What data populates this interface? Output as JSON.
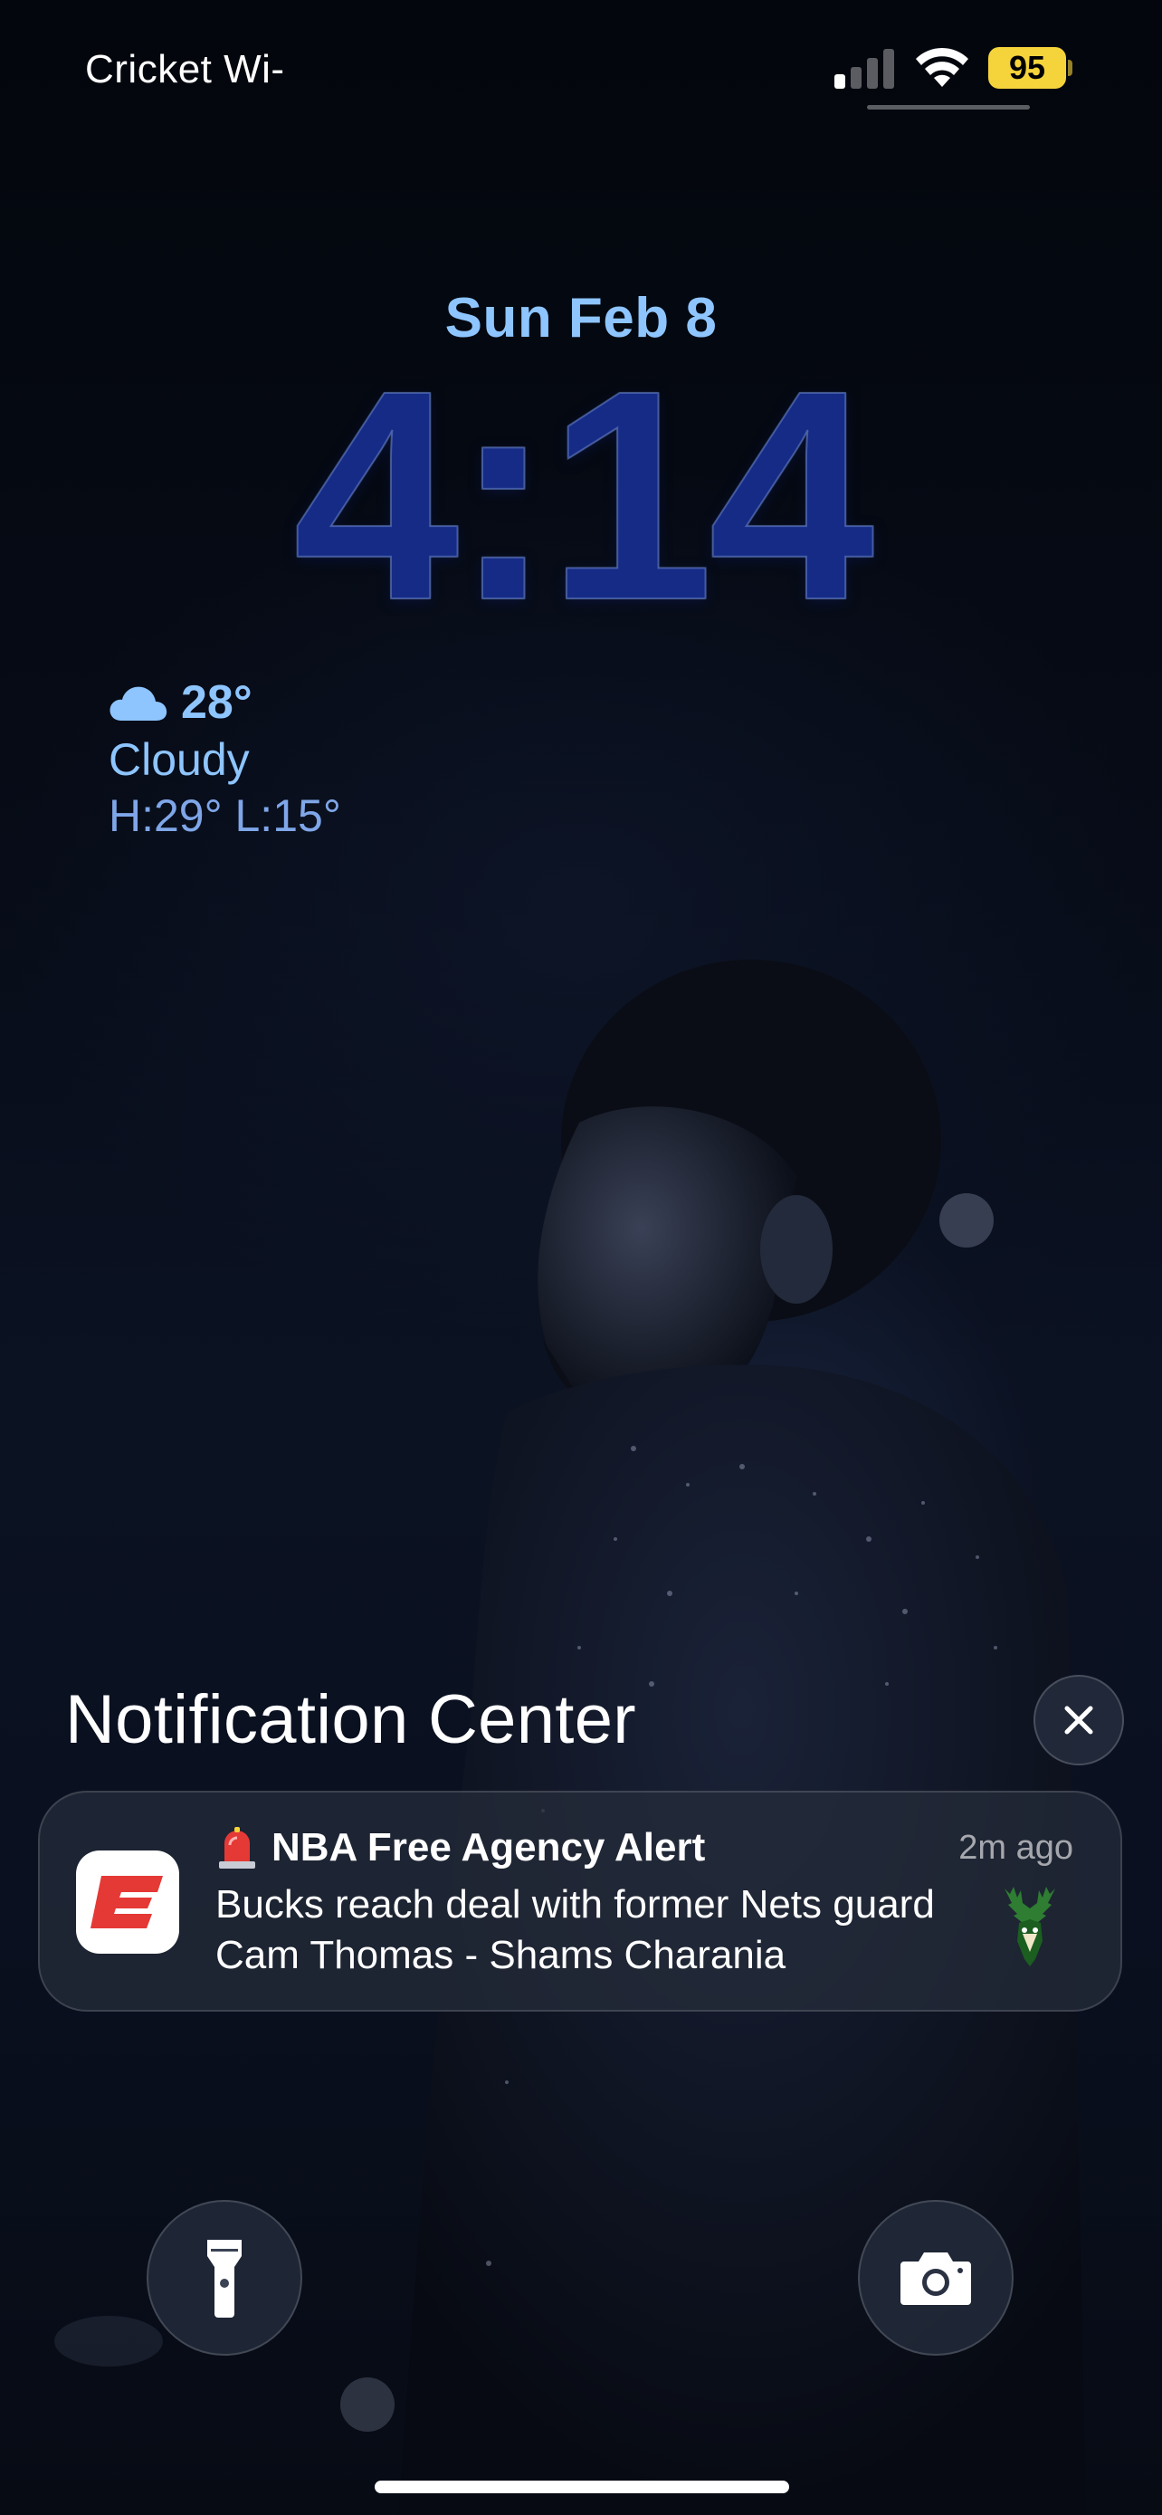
{
  "status_bar": {
    "carrier": "Cricket Wi-",
    "battery": "95",
    "battery_color": "#f5d33b",
    "signal_bars_active": 1,
    "icons": [
      "cellular-signal-icon",
      "wifi-icon",
      "battery-icon"
    ]
  },
  "lock_screen": {
    "date": "Sun Feb 8",
    "time": "4:14",
    "accent_color": "#8ec5ff",
    "clock_color": "#162b86"
  },
  "weather": {
    "icon": "cloud-icon",
    "temperature": "28°",
    "condition": "Cloudy",
    "high_low": "H:29° L:15°"
  },
  "notification_center": {
    "title": "Notification Center",
    "clear_icon": "close-icon",
    "notifications": [
      {
        "app_icon": "espn-app-icon",
        "title_emoji_icon": "siren-icon",
        "title": "NBA Free Agency Alert",
        "time": "2m ago",
        "body": "Bucks reach deal with former Nets guard Cam Thomas - Shams Charania",
        "thumbnail_icon": "bucks-logo-icon"
      }
    ]
  },
  "quick_actions": {
    "left": "flashlight-icon",
    "right": "camera-icon"
  }
}
